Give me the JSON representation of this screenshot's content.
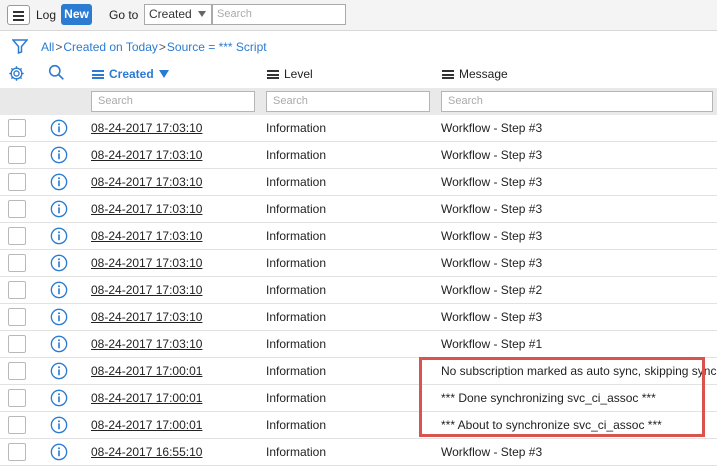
{
  "toolbar": {
    "title": "Log",
    "new_label": "New",
    "goto_label": "Go to",
    "goto_field": "Created",
    "search_placeholder": "Search"
  },
  "breadcrumb": {
    "all": "All",
    "filter1": "Created on Today",
    "filter2": "Source = *** Script",
    "sep": ">"
  },
  "columns": {
    "created": "Created",
    "level": "Level",
    "message": "Message",
    "search_placeholder": "Search"
  },
  "rows": [
    {
      "created": "08-24-2017 17:03:10",
      "level": "Information",
      "message": "Workflow - Step #3"
    },
    {
      "created": "08-24-2017 17:03:10",
      "level": "Information",
      "message": "Workflow - Step #3"
    },
    {
      "created": "08-24-2017 17:03:10",
      "level": "Information",
      "message": "Workflow - Step #3"
    },
    {
      "created": "08-24-2017 17:03:10",
      "level": "Information",
      "message": "Workflow - Step #3"
    },
    {
      "created": "08-24-2017 17:03:10",
      "level": "Information",
      "message": "Workflow - Step #3"
    },
    {
      "created": "08-24-2017 17:03:10",
      "level": "Information",
      "message": "Workflow - Step #3"
    },
    {
      "created": "08-24-2017 17:03:10",
      "level": "Information",
      "message": "Workflow - Step #2"
    },
    {
      "created": "08-24-2017 17:03:10",
      "level": "Information",
      "message": "Workflow - Step #3"
    },
    {
      "created": "08-24-2017 17:03:10",
      "level": "Information",
      "message": "Workflow - Step #1"
    },
    {
      "created": "08-24-2017 17:00:01",
      "level": "Information",
      "message": "No subscription marked as auto sync, skipping sync"
    },
    {
      "created": "08-24-2017 17:00:01",
      "level": "Information",
      "message": "*** Done synchronizing svc_ci_assoc ***"
    },
    {
      "created": "08-24-2017 17:00:01",
      "level": "Information",
      "message": "*** About to synchronize svc_ci_assoc ***"
    },
    {
      "created": "08-24-2017 16:55:10",
      "level": "Information",
      "message": "Workflow - Step #3"
    }
  ],
  "colors": {
    "accent": "#2b7bd2",
    "highlight": "#d9534f"
  }
}
